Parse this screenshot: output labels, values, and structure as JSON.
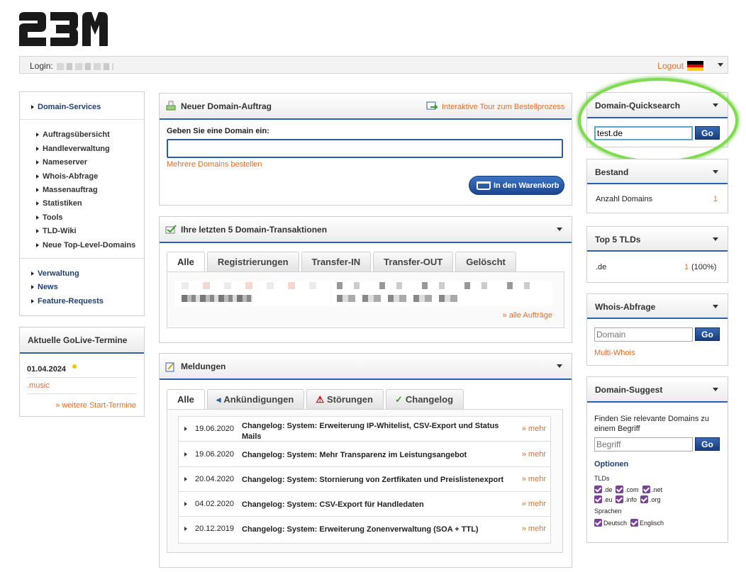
{
  "logo_text": "23M",
  "header": {
    "login_label": "Login:",
    "logout_label": "Logout",
    "language_flag": "de-flag-icon"
  },
  "nav": {
    "main": "Domain-Services",
    "sub": [
      "Auftragsübersicht",
      "Handleverwaltung",
      "Nameserver",
      "Whois-Abfrage",
      "Massenauftrag",
      "Statistiken",
      "Tools",
      "TLD-Wiki",
      "Neue Top-Level-Domains"
    ],
    "other": [
      "Verwaltung",
      "News",
      "Feature-Requests"
    ]
  },
  "golive": {
    "title": "Aktuelle GoLive-Termine",
    "date": "01.04.2024",
    "tld": ".music",
    "more": "» weitere Start-Termine"
  },
  "neu": {
    "title": "Neuer Domain-Auftrag",
    "tour": "Interaktive Tour zum Bestellprozess",
    "label": "Geben Sie eine Domain ein:",
    "multi": "Mehrere Domains bestellen",
    "cart_button": "In den Warenkorb",
    "input_value": ""
  },
  "letzte": {
    "title": "Ihre letzten 5 Domain-Transaktionen",
    "tabs": [
      "Alle",
      "Registrierungen",
      "Transfer-IN",
      "Transfer-OUT",
      "Gelöscht"
    ],
    "all_orders": "» alle Aufträge"
  },
  "meld": {
    "title": "Meldungen",
    "tabs": [
      "Alle",
      "Ankündigungen",
      "Störungen",
      "Changelog"
    ],
    "more": "» mehr",
    "rows": [
      {
        "date": "19.06.2020",
        "text": "Changelog: System: Erweiterung IP-Whitelist, CSV-Export und Status Mails"
      },
      {
        "date": "19.06.2020",
        "text": "Changelog: System: Mehr Transparenz im Leistungsangebot"
      },
      {
        "date": "20.04.2020",
        "text": "Changelog: System: Stornierung von Zertfikaten und Preislistenexport"
      },
      {
        "date": "04.02.2020",
        "text": "Changelog: System: CSV-Export für Handledaten"
      },
      {
        "date": "20.12.2019",
        "text": "Changelog: System: Erweiterung Zonenverwaltung (SOA + TTL)"
      }
    ]
  },
  "quick": {
    "title": "Domain-Quicksearch",
    "value": "test.de",
    "go": "Go"
  },
  "bestand": {
    "title": "Bestand",
    "label": "Anzahl Domains",
    "count": "1"
  },
  "top5": {
    "title": "Top 5 TLDs",
    "tld": ".de",
    "count": "1",
    "pct": "(100%)"
  },
  "whois": {
    "title": "Whois-Abfrage",
    "placeholder": "Domain",
    "go": "Go",
    "multi": "Multi-Whois"
  },
  "suggest": {
    "title": "Domain-Suggest",
    "desc": "Finden Sie relevante Domains zu einem Begriff",
    "placeholder": "Begriff",
    "go": "Go",
    "options": "Optionen",
    "tlds_label": "TLDs",
    "tlds": [
      ".de",
      ".com",
      ".net",
      ".eu",
      ".info",
      ".org"
    ],
    "lang_label": "Sprachen",
    "langs": [
      "Deutsch",
      "Englisch"
    ]
  }
}
